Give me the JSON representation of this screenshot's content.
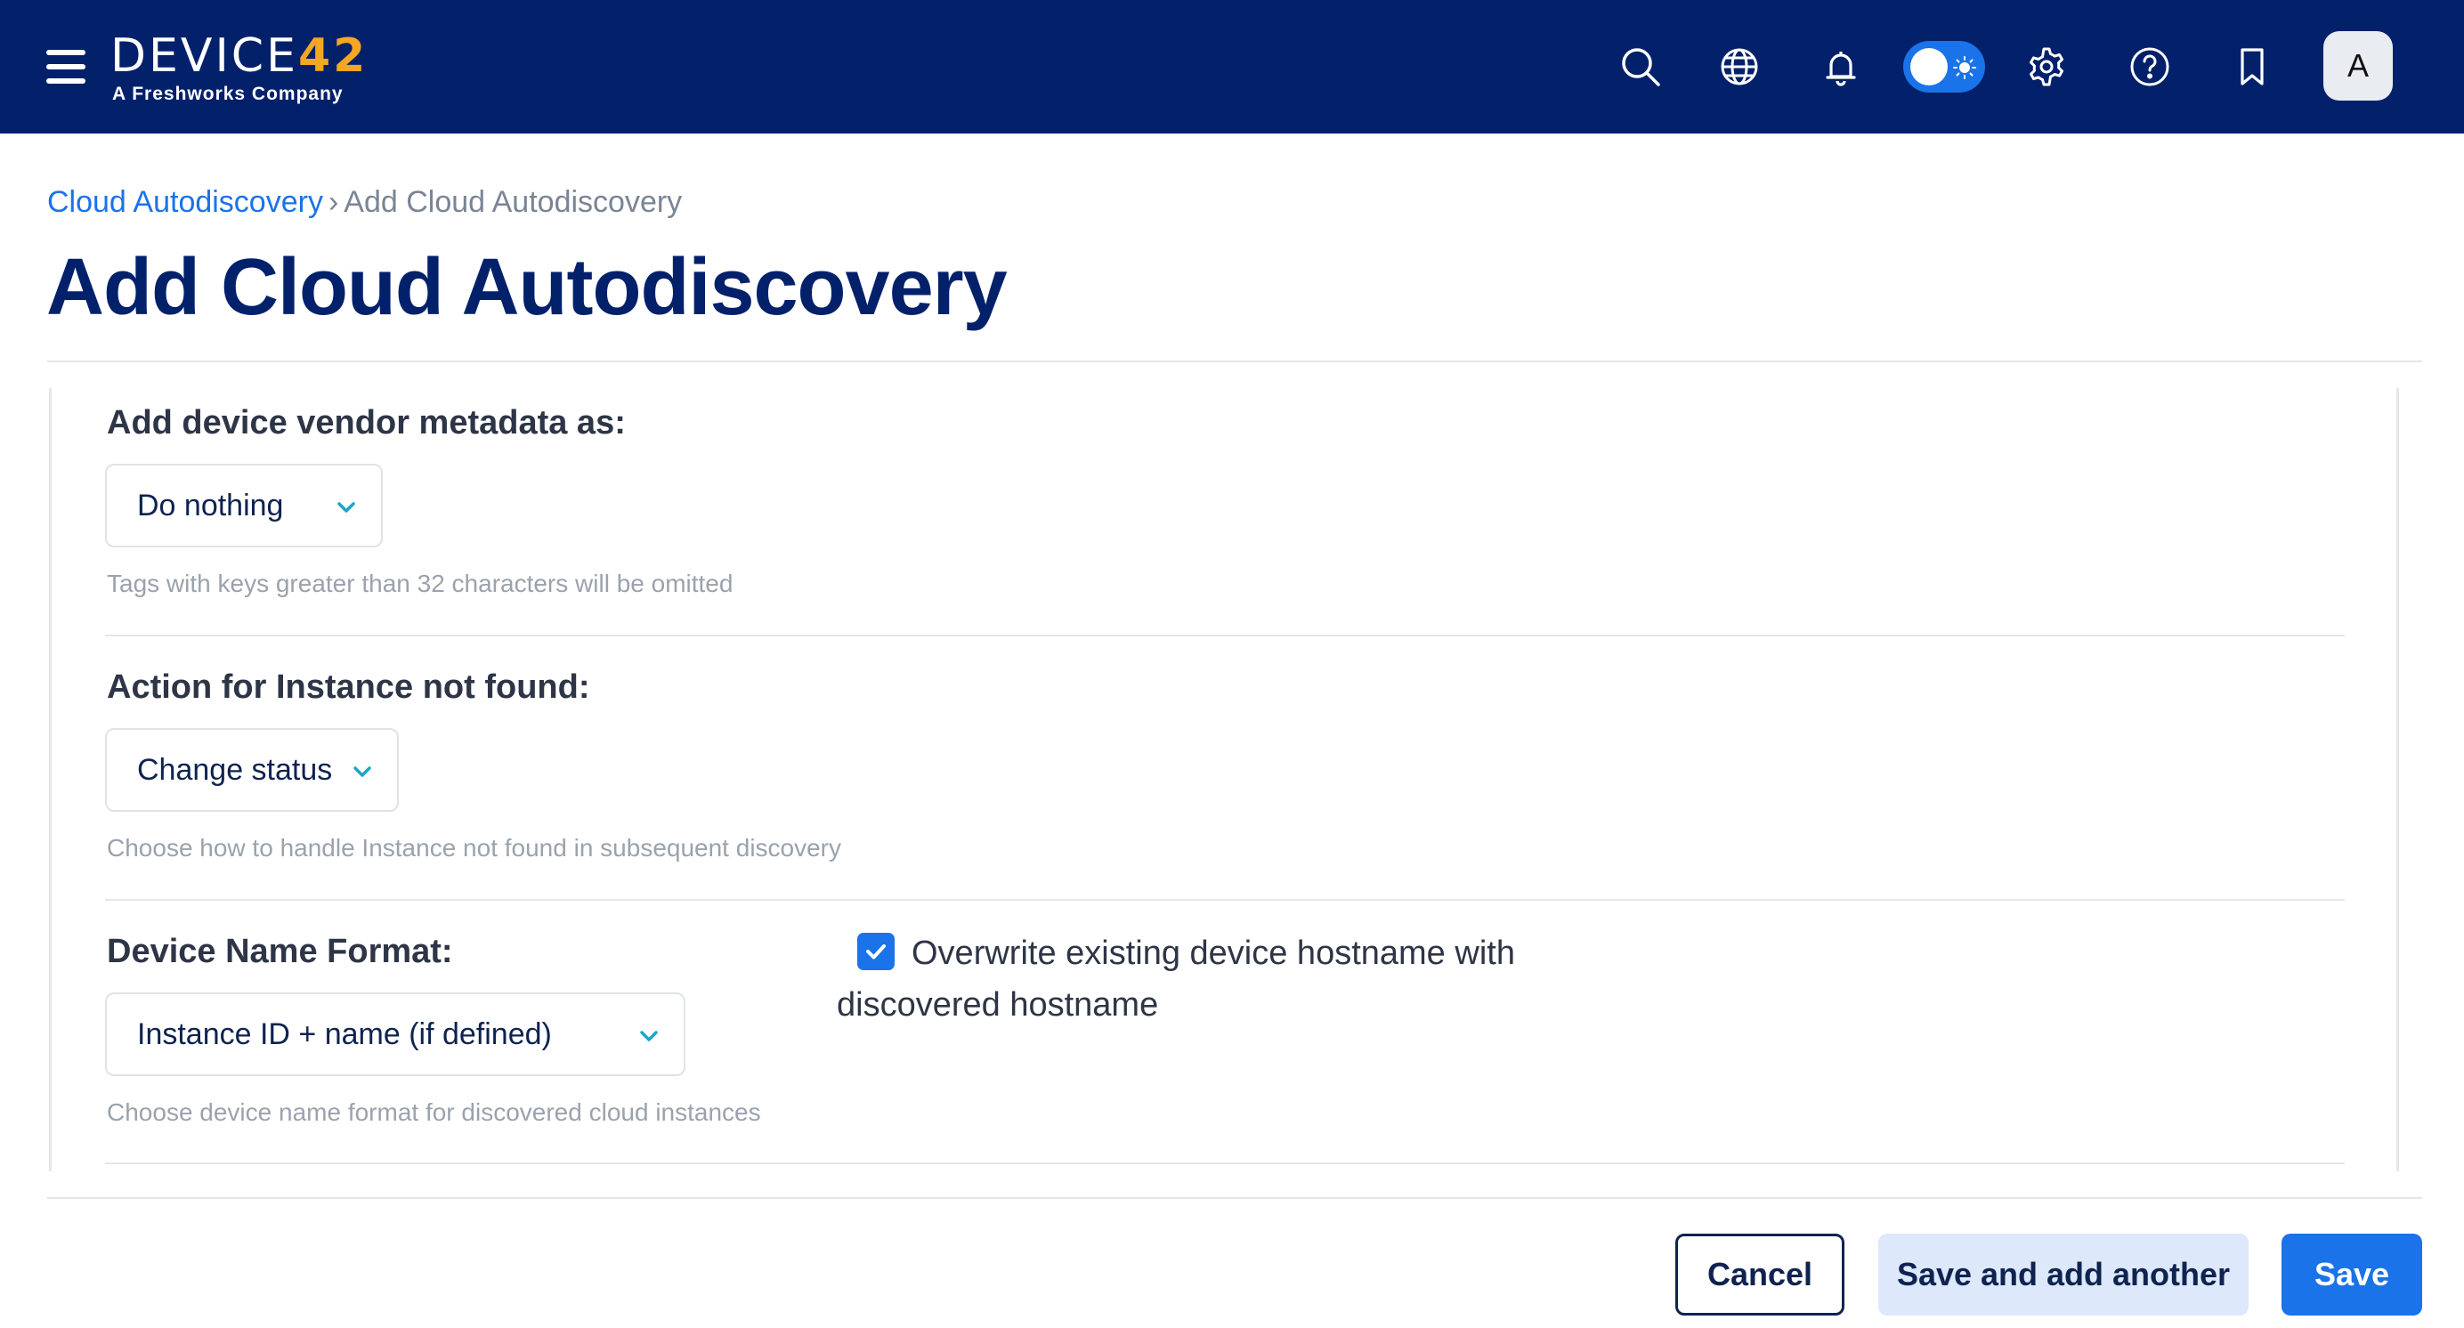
{
  "header": {
    "logo_main": "DEVICE",
    "logo_num": "42",
    "logo_sub": "A Freshworks Company",
    "avatar_initial": "A",
    "icons": [
      "menu-icon",
      "search-icon",
      "globe-icon",
      "bell-icon",
      "theme-toggle",
      "gear-icon",
      "help-icon",
      "bookmark-icon"
    ]
  },
  "breadcrumb": {
    "parent": "Cloud Autodiscovery",
    "separator": "›",
    "current": "Add Cloud Autodiscovery"
  },
  "page": {
    "title": "Add Cloud Autodiscovery"
  },
  "form": {
    "vendor_metadata": {
      "label": "Add device vendor metadata as:",
      "value": "Do nothing",
      "hint": "Tags with keys greater than 32 characters will be omitted"
    },
    "instance_not_found": {
      "label": "Action for Instance not found:",
      "value": "Change status",
      "hint": "Choose how to handle Instance not found in subsequent discovery"
    },
    "device_name_format": {
      "label": "Device Name Format:",
      "value": "Instance ID + name (if defined)",
      "hint": "Choose device name format for discovered cloud instances"
    },
    "overwrite_hostname": {
      "label": "Overwrite existing device hostname with discovered hostname",
      "checked": true
    }
  },
  "footer": {
    "cancel_label": "Cancel",
    "save_another_label": "Save and add another",
    "save_label": "Save"
  },
  "colors": {
    "topbar": "#03216b",
    "accent": "#1a73e8",
    "logo_accent": "#f5a623"
  }
}
